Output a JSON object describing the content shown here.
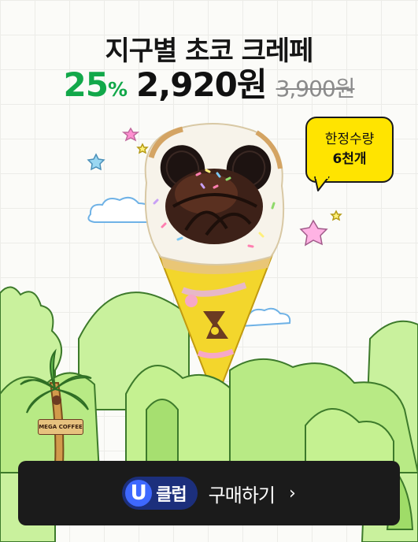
{
  "product": {
    "title": "지구별 초코 크레페",
    "discount_number": "25",
    "discount_unit": "%",
    "price": "2,920원",
    "original_price": "3,900원"
  },
  "badge": {
    "line1": "한정수량",
    "line2": "6천개"
  },
  "brand": {
    "logo_text": "MEGA COFFEE"
  },
  "buy_bar": {
    "u_letter": "U",
    "club_label": "클럽",
    "action_label": "구매하기",
    "chevron": "›"
  },
  "colors": {
    "discount_green": "#12a84a",
    "badge_yellow": "#ffe400",
    "button_dark": "#1b1b1b",
    "uclub_navy": "#1c2f7c"
  }
}
